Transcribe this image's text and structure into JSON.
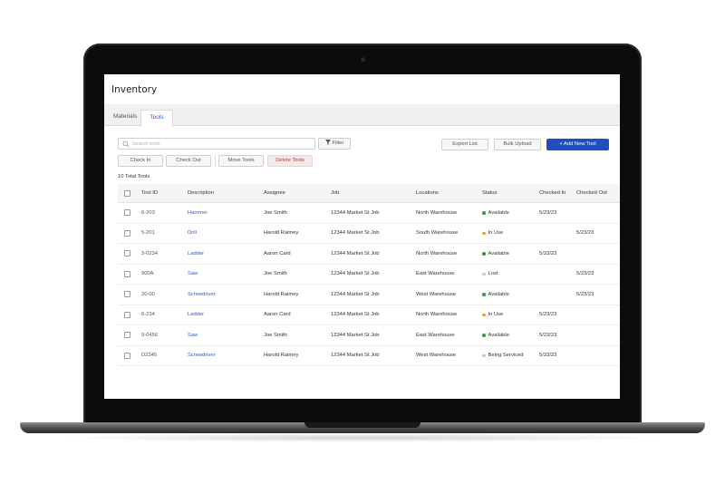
{
  "page": {
    "title": "Inventory"
  },
  "tabs": [
    {
      "label": "Materials",
      "active": false
    },
    {
      "label": "Tools",
      "active": true
    }
  ],
  "toolbar": {
    "search_placeholder": "Search tools",
    "filter_label": "Filter",
    "export_label": "Export List",
    "bulk_label": "Bulk Upload",
    "add_label": "+ Add New Tool",
    "checkin_label": "Check In",
    "checkout_label": "Check Out",
    "move_label": "Move Tools",
    "delete_label": "Delete Tools"
  },
  "summary": {
    "total": "10 Total Tools"
  },
  "table": {
    "columns": [
      "Tool ID",
      "Description",
      "Assignee",
      "Job",
      "Locations",
      "Status",
      "Checked In",
      "Checked Out"
    ],
    "rows": [
      {
        "id": "6-203",
        "description": "Hammer",
        "assignee": "Joe Smith",
        "job": "12344 Market St Job",
        "location": "North Warehouse",
        "status": "Available",
        "checked_in": "5/23/23",
        "checked_out": ""
      },
      {
        "id": "5-201",
        "description": "Drill",
        "assignee": "Harold Raimey",
        "job": "12344 Market St Job",
        "location": "South Warehouse",
        "status": "In Use",
        "checked_in": "",
        "checked_out": "5/23/23"
      },
      {
        "id": "3-0234",
        "description": "Ladder",
        "assignee": "Aaron Card",
        "job": "12344 Market St Job",
        "location": "North Warehouse",
        "status": "Available",
        "checked_in": "5/23/23",
        "checked_out": ""
      },
      {
        "id": "900A",
        "description": "Saw",
        "assignee": "Joe Smith",
        "job": "12344 Market St Job",
        "location": "East Warehouse",
        "status": "Lost",
        "checked_in": "",
        "checked_out": "5/23/23"
      },
      {
        "id": "20-00",
        "description": "Screwdriver",
        "assignee": "Harold Raimey",
        "job": "12344 Market St Job",
        "location": "West Warehouse",
        "status": "Available",
        "checked_in": "",
        "checked_out": "5/23/23"
      },
      {
        "id": "6-234",
        "description": "Ladder",
        "assignee": "Aaron Card",
        "job": "12344 Market St Job",
        "location": "North Warehouse",
        "status": "In Use",
        "checked_in": "5/23/23",
        "checked_out": ""
      },
      {
        "id": "9-0456",
        "description": "Saw",
        "assignee": "Joe Smith",
        "job": "12344 Market St Job",
        "location": "East Warehouse",
        "status": "Available",
        "checked_in": "5/23/23",
        "checked_out": ""
      },
      {
        "id": "D2345",
        "description": "Screwdriver",
        "assignee": "Harold Raimey",
        "job": "12344 Market St Job",
        "location": "West Warehouse",
        "status": "Being Serviced",
        "checked_in": "5/23/23",
        "checked_out": ""
      }
    ]
  },
  "status_colors": {
    "Available": "#2e9e3e",
    "In Use": "#f0a020",
    "Lost": "#c8c8c8",
    "Being Serviced": "#c8c8c8"
  },
  "colors": {
    "accent": "#1f4fbf",
    "link": "#2d63c8",
    "danger": "#c03535"
  }
}
